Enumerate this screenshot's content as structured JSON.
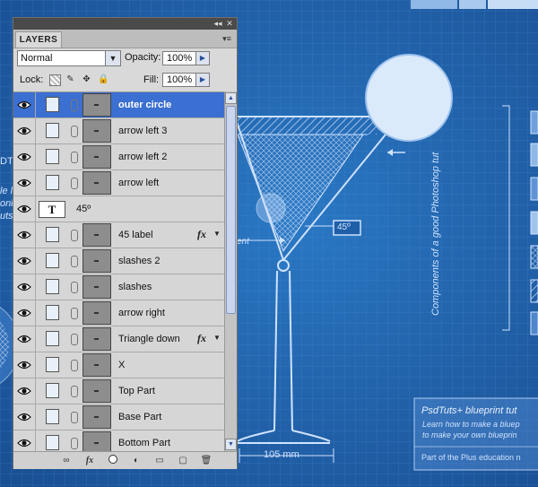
{
  "panel": {
    "tab_label": "LAYERS",
    "collapse_glyph": "◂◂",
    "close_glyph": "✕",
    "menu_glyph": "▾≡",
    "blend_mode": "Normal",
    "opacity_label": "Opacity:",
    "opacity_value": "100%",
    "lock_label": "Lock:",
    "fill_label": "Fill:",
    "fill_value": "100%"
  },
  "layers": [
    {
      "name": "outer circle",
      "selected": true,
      "type": "shape",
      "fx": false
    },
    {
      "name": "arrow left 3",
      "selected": false,
      "type": "shape",
      "fx": false
    },
    {
      "name": "arrow left 2",
      "selected": false,
      "type": "shape",
      "fx": false
    },
    {
      "name": "arrow left",
      "selected": false,
      "type": "shape",
      "fx": false
    },
    {
      "name": "45º",
      "selected": false,
      "type": "text",
      "fx": false
    },
    {
      "name": "45 label",
      "selected": false,
      "type": "shape",
      "fx": true
    },
    {
      "name": "slashes 2",
      "selected": false,
      "type": "shape",
      "fx": false
    },
    {
      "name": "slashes",
      "selected": false,
      "type": "shape",
      "fx": false
    },
    {
      "name": "arrow right",
      "selected": false,
      "type": "shape",
      "fx": false
    },
    {
      "name": "Triangle down",
      "selected": false,
      "type": "shape",
      "fx": true
    },
    {
      "name": "X",
      "selected": false,
      "type": "shape",
      "fx": false
    },
    {
      "name": "Top Part",
      "selected": false,
      "type": "shape",
      "fx": false
    },
    {
      "name": "Base Part",
      "selected": false,
      "type": "shape",
      "fx": false
    },
    {
      "name": "Bottom Part",
      "selected": false,
      "type": "shape",
      "fx": false
    }
  ],
  "text_thumb_glyph": "T",
  "bottom_icons": [
    "link-icon",
    "fx-icon",
    "mask-icon",
    "adjustment-icon",
    "folder-icon",
    "new-layer-icon",
    "trash-icon"
  ],
  "bottom_glyphs": {
    "fx": "fx",
    "adjust": "◐",
    "folder": "▭",
    "new": "▢",
    "trash": "🗑"
  },
  "canvas": {
    "angle_label": "45º",
    "measure_label": "105 mm",
    "vertical_caption": "Components of a good Photoshop tut",
    "partial_left_1": "DT",
    "partial_left_2": "le l",
    "partial_left_3": "onl",
    "partial_left_4": "uts",
    "partial_ent": "ent",
    "box_title": "PsdTuts+ blueprint tut",
    "box_line1": "Learn how to make a bluep",
    "box_line2": "to make your own blueprin",
    "box_footer": "Part of the Plus education n"
  },
  "colors": {
    "background": "#1f5fa8",
    "selection": "#3b6fd1",
    "blueprint_line": "#cfe2ff"
  }
}
